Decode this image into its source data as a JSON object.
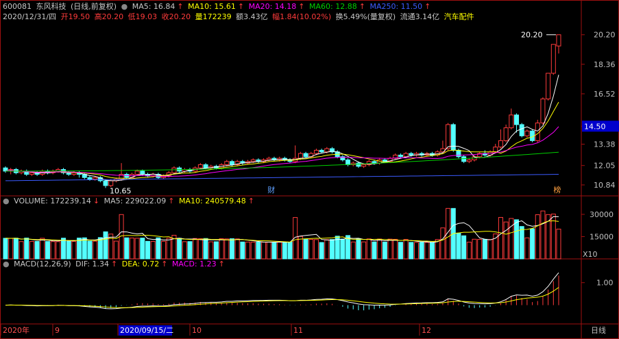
{
  "header": {
    "code": "600081",
    "name": "东风科技",
    "period": "(日线,前复权)",
    "ma5_label": "MA5: 16.84",
    "ma10_label": "MA10: 15.61",
    "ma20_label": "MA20: 14.18",
    "ma60_label": "MA60: 12.88",
    "ma250_label": "MA250: 11.50",
    "info_date": "2020/12/31/四",
    "info_open": "开19.50",
    "info_high": "高20.20",
    "info_low": "低19.03",
    "info_close": "收20.20",
    "info_vol": "量172239",
    "info_amount": "额3.43亿",
    "info_change": "幅1.84(10.02%)",
    "info_turnover": "换5.49%(量复权)",
    "info_float": "流通3.14亿",
    "info_sector": "汽车配件"
  },
  "volume_header": {
    "vol_label": "VOLUME: 172239.14",
    "ma5_label": "MA5: 229022.09",
    "ma10_label": "MA10: 240579.48"
  },
  "macd_header": {
    "title": "MACD(12,26,9)",
    "dif_label": "DIF: 1.34",
    "dea_label": "DEA: 0.72",
    "macd_label": "MACD: 1.23"
  },
  "colors": {
    "up": "#ff3b3b",
    "down": "#54ffff",
    "ma5": "#ffffff",
    "ma10": "#ffff00",
    "ma20": "#ff00ff",
    "ma60": "#00d000",
    "ma250": "#3b5bff",
    "grid": "#a01010",
    "price_tag_bg": "#0000cc"
  },
  "chart_data": {
    "type": "candlestick",
    "symbol": "600081",
    "x_labels": [
      "2020年",
      "9",
      "2020/09/15/二",
      "10",
      "11",
      "12",
      "日线"
    ],
    "price_axis_ticks": [
      20.2,
      18.36,
      16.52,
      14.5,
      13.38,
      12.05,
      10.84
    ],
    "price_ylim": [
      10.2,
      21.0
    ],
    "current_price_tag": "14.50",
    "high_annotation": "20.20",
    "low_annotation": "10.65",
    "markers": [
      "财",
      "榜"
    ],
    "candles": [
      [
        11.9,
        11.7,
        12.0,
        11.6
      ],
      [
        11.7,
        11.8,
        11.9,
        11.5
      ],
      [
        11.8,
        11.6,
        11.9,
        11.5
      ],
      [
        11.6,
        11.7,
        11.8,
        11.5
      ],
      [
        11.7,
        11.5,
        11.8,
        11.4
      ],
      [
        11.5,
        11.6,
        11.7,
        11.4
      ],
      [
        11.6,
        11.5,
        11.7,
        11.4
      ],
      [
        11.5,
        11.7,
        11.8,
        11.4
      ],
      [
        11.7,
        11.6,
        11.8,
        11.5
      ],
      [
        11.6,
        11.7,
        11.8,
        11.5
      ],
      [
        11.7,
        11.8,
        11.9,
        11.6
      ],
      [
        11.8,
        11.6,
        11.9,
        11.5
      ],
      [
        11.6,
        11.5,
        11.7,
        11.4
      ],
      [
        11.5,
        11.6,
        11.7,
        11.4
      ],
      [
        11.6,
        11.5,
        11.7,
        11.3
      ],
      [
        11.5,
        11.3,
        11.6,
        11.2
      ],
      [
        11.3,
        11.2,
        11.4,
        11.1
      ],
      [
        11.2,
        11.3,
        11.4,
        11.1
      ],
      [
        11.3,
        11.1,
        11.4,
        11.0
      ],
      [
        11.1,
        10.8,
        11.2,
        10.65
      ],
      [
        10.8,
        11.1,
        11.2,
        10.7
      ],
      [
        11.1,
        11.2,
        11.3,
        11.0
      ],
      [
        11.2,
        11.5,
        12.2,
        11.1
      ],
      [
        11.5,
        11.3,
        11.6,
        11.2
      ],
      [
        11.3,
        11.5,
        11.6,
        11.2
      ],
      [
        11.5,
        11.7,
        11.8,
        11.4
      ],
      [
        11.7,
        11.5,
        11.8,
        11.4
      ],
      [
        11.5,
        11.4,
        11.6,
        11.3
      ],
      [
        11.4,
        11.5,
        11.6,
        11.3
      ],
      [
        11.5,
        11.3,
        11.6,
        11.2
      ],
      [
        11.3,
        11.4,
        11.5,
        11.2
      ],
      [
        11.4,
        11.6,
        11.7,
        11.3
      ],
      [
        11.6,
        11.9,
        12.0,
        11.5
      ],
      [
        11.9,
        11.7,
        12.0,
        11.6
      ],
      [
        11.7,
        11.8,
        11.9,
        11.6
      ],
      [
        11.8,
        11.7,
        11.9,
        11.6
      ],
      [
        11.7,
        11.9,
        12.0,
        11.6
      ],
      [
        11.9,
        12.1,
        12.2,
        11.8
      ],
      [
        12.1,
        11.9,
        12.2,
        11.8
      ],
      [
        11.9,
        12.0,
        12.1,
        11.8
      ],
      [
        12.0,
        11.9,
        12.1,
        11.8
      ],
      [
        11.9,
        12.1,
        12.2,
        11.8
      ],
      [
        12.1,
        12.3,
        12.4,
        12.0
      ],
      [
        12.3,
        12.1,
        12.4,
        12.0
      ],
      [
        12.1,
        12.3,
        12.4,
        12.0
      ],
      [
        12.3,
        12.2,
        12.4,
        12.1
      ],
      [
        12.2,
        12.3,
        12.4,
        12.1
      ],
      [
        12.3,
        12.4,
        12.5,
        12.2
      ],
      [
        12.4,
        12.3,
        12.5,
        12.2
      ],
      [
        12.3,
        12.4,
        12.5,
        12.2
      ],
      [
        12.4,
        12.5,
        12.6,
        12.3
      ],
      [
        12.5,
        12.4,
        12.6,
        12.3
      ],
      [
        12.4,
        12.5,
        12.6,
        12.3
      ],
      [
        12.5,
        12.4,
        12.6,
        12.3
      ],
      [
        12.4,
        12.3,
        12.5,
        12.2
      ],
      [
        12.3,
        12.5,
        13.3,
        12.2
      ],
      [
        12.5,
        12.8,
        12.9,
        12.4
      ],
      [
        12.8,
        12.6,
        12.9,
        12.5
      ],
      [
        12.6,
        12.8,
        12.9,
        12.5
      ],
      [
        12.8,
        13.0,
        13.1,
        12.7
      ],
      [
        13.0,
        12.9,
        13.1,
        12.8
      ],
      [
        12.9,
        13.1,
        13.2,
        12.8
      ],
      [
        13.1,
        12.9,
        13.2,
        12.8
      ],
      [
        12.9,
        12.6,
        13.0,
        12.5
      ],
      [
        12.6,
        12.4,
        12.7,
        12.3
      ],
      [
        12.4,
        12.1,
        12.5,
        12.0
      ],
      [
        12.1,
        12.2,
        12.3,
        12.0
      ],
      [
        12.2,
        12.0,
        12.3,
        11.9
      ],
      [
        12.0,
        12.1,
        12.2,
        11.9
      ],
      [
        12.1,
        12.3,
        12.4,
        12.0
      ],
      [
        12.3,
        12.2,
        12.4,
        12.1
      ],
      [
        12.2,
        12.4,
        12.5,
        12.1
      ],
      [
        12.4,
        12.3,
        12.5,
        12.2
      ],
      [
        12.3,
        12.5,
        12.6,
        12.2
      ],
      [
        12.5,
        12.7,
        12.8,
        12.4
      ],
      [
        12.7,
        12.6,
        12.8,
        12.5
      ],
      [
        12.6,
        12.8,
        12.9,
        12.5
      ],
      [
        12.8,
        12.7,
        12.9,
        12.6
      ],
      [
        12.7,
        12.8,
        12.9,
        12.6
      ],
      [
        12.8,
        12.7,
        12.9,
        12.6
      ],
      [
        12.7,
        12.8,
        12.9,
        12.6
      ],
      [
        12.8,
        12.7,
        12.9,
        12.6
      ],
      [
        12.7,
        12.9,
        13.0,
        12.6
      ],
      [
        12.9,
        13.1,
        13.6,
        12.8
      ],
      [
        13.1,
        14.6,
        14.7,
        13.0
      ],
      [
        14.6,
        13.0,
        14.7,
        12.9
      ],
      [
        13.0,
        12.6,
        13.1,
        12.5
      ],
      [
        12.6,
        12.3,
        12.7,
        12.2
      ],
      [
        12.3,
        12.4,
        12.5,
        12.2
      ],
      [
        12.4,
        12.6,
        12.7,
        12.3
      ],
      [
        12.6,
        12.8,
        12.9,
        12.5
      ],
      [
        12.8,
        12.7,
        13.0,
        12.6
      ],
      [
        12.7,
        12.9,
        13.0,
        12.6
      ],
      [
        12.9,
        13.2,
        13.4,
        12.8
      ],
      [
        13.2,
        13.6,
        14.3,
        13.1
      ],
      [
        13.6,
        14.4,
        14.6,
        13.5
      ],
      [
        14.4,
        15.2,
        15.6,
        14.3
      ],
      [
        15.2,
        14.6,
        15.3,
        14.1
      ],
      [
        14.6,
        13.9,
        14.7,
        13.8
      ],
      [
        13.9,
        14.2,
        14.3,
        13.8
      ],
      [
        14.2,
        13.6,
        14.3,
        13.5
      ],
      [
        13.6,
        14.7,
        14.9,
        13.5
      ],
      [
        14.7,
        16.2,
        16.3,
        14.6
      ],
      [
        16.2,
        17.8,
        17.8,
        16.1
      ],
      [
        17.8,
        19.6,
        19.6,
        17.7
      ],
      [
        19.5,
        20.2,
        20.2,
        19.03
      ]
    ],
    "moving_averages": {
      "MA5": 16.84,
      "MA10": 15.61,
      "MA20": 14.18,
      "MA60": 12.88,
      "MA250": 11.5
    },
    "volume_axis_ticks": [
      30000,
      15000
    ],
    "volume_unit": "X10",
    "macd_axis_ticks": [
      1.0
    ],
    "macd": {
      "DIF": 1.34,
      "DEA": 0.72,
      "MACD": 1.23
    }
  }
}
